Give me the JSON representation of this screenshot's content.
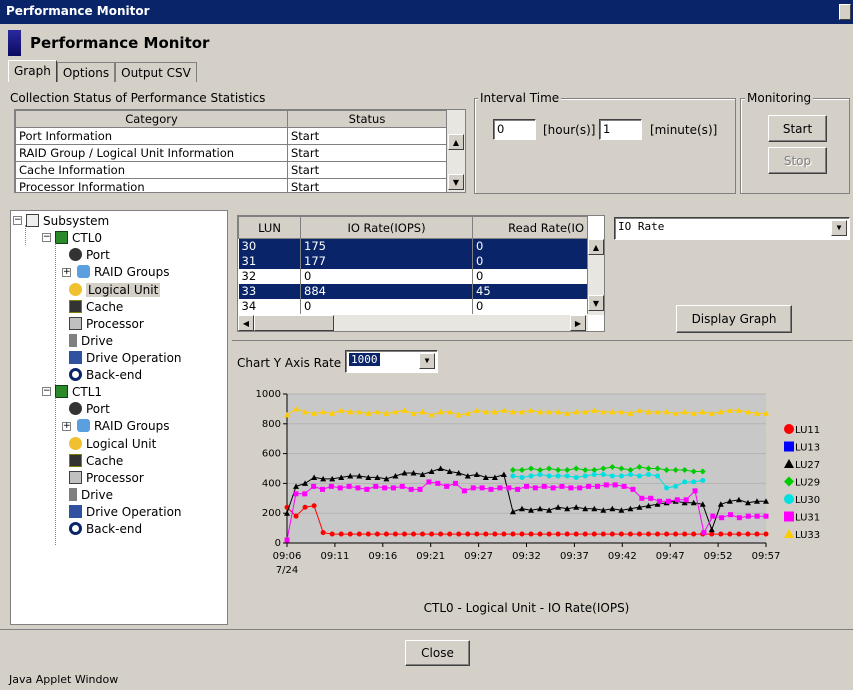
{
  "window": {
    "title": "Performance Monitor"
  },
  "header": {
    "title": "Performance Monitor"
  },
  "tabs": [
    {
      "label": "Graph"
    },
    {
      "label": "Options"
    },
    {
      "label": "Output CSV"
    }
  ],
  "collection": {
    "title": "Collection Status of Performance Statistics",
    "col_category": "Category",
    "col_status": "Status",
    "rows": [
      {
        "category": "Port Information",
        "status": "Start"
      },
      {
        "category": "RAID Group / Logical Unit Information",
        "status": "Start"
      },
      {
        "category": "Cache Information",
        "status": "Start"
      },
      {
        "category": "Processor Information",
        "status": "Start"
      }
    ]
  },
  "interval": {
    "title": "Interval Time",
    "hours_value": "0",
    "hours_label": "[hour(s)]",
    "minutes_value": "1",
    "minutes_label": "[minute(s)]"
  },
  "monitoring": {
    "title": "Monitoring",
    "start": "Start",
    "stop": "Stop"
  },
  "tree": {
    "root": "Subsystem",
    "controllers": [
      {
        "label": "CTL0",
        "items": [
          "Port",
          "RAID Groups",
          "Logical Unit",
          "Cache",
          "Processor",
          "Drive",
          "Drive Operation",
          "Back-end"
        ]
      },
      {
        "label": "CTL1",
        "items": [
          "Port",
          "RAID Groups",
          "Logical Unit",
          "Cache",
          "Processor",
          "Drive",
          "Drive Operation",
          "Back-end"
        ]
      }
    ]
  },
  "lun_table": {
    "headers": [
      "LUN",
      "IO Rate(IOPS)",
      "Read Rate(IO"
    ],
    "rows": [
      [
        "30",
        "175",
        "0"
      ],
      [
        "31",
        "177",
        "0"
      ],
      [
        "32",
        "0",
        "0"
      ],
      [
        "33",
        "884",
        "45"
      ],
      [
        "34",
        "0",
        "0"
      ]
    ]
  },
  "metric_select": {
    "value": "IO Rate"
  },
  "display_graph": "Display Graph",
  "axis_rate": {
    "label": "Chart Y Axis Rate",
    "value": "1000"
  },
  "chart_data": {
    "type": "line",
    "title": "CTL0 - Logical Unit - IO Rate(IOPS)",
    "xlabel": "",
    "ylabel": "",
    "ylim": [
      0,
      1000
    ],
    "y_ticks": [
      "0",
      "200",
      "400",
      "600",
      "800",
      "1000"
    ],
    "x_ticks": [
      "09:06",
      "09:11",
      "09:16",
      "09:21",
      "09:27",
      "09:32",
      "09:37",
      "09:42",
      "09:47",
      "09:52",
      "09:57"
    ],
    "x_date": "7/24",
    "legend_position": "right",
    "series": [
      {
        "name": "LU11",
        "color": "#ff0000",
        "marker": "circle",
        "values": [
          240,
          180,
          240,
          250,
          70,
          60,
          60,
          60,
          60,
          60,
          60,
          60,
          60,
          60,
          60,
          60,
          60,
          60,
          60,
          60,
          60,
          60,
          60,
          60,
          60,
          60,
          60,
          60,
          60,
          60,
          60,
          60,
          60,
          60,
          60,
          60,
          60,
          60,
          60,
          60,
          60,
          60,
          60,
          60,
          60,
          60,
          60,
          60,
          60,
          60,
          60,
          60,
          60,
          60
        ]
      },
      {
        "name": "LU13",
        "color": "#0000ff",
        "marker": "square",
        "values": [
          null,
          null,
          null,
          null,
          null,
          null,
          null,
          null,
          null,
          null,
          null,
          null,
          null,
          null,
          null,
          null,
          null,
          null,
          null,
          null,
          null,
          null,
          null,
          null,
          null,
          null,
          null,
          null,
          null,
          null,
          null,
          null,
          null,
          null,
          null,
          null,
          null,
          null,
          null,
          null,
          null,
          null,
          null,
          null,
          null,
          null,
          null,
          null,
          null,
          null,
          null,
          null,
          null,
          null
        ]
      },
      {
        "name": "LU27",
        "color": "#000000",
        "marker": "triangle",
        "values": [
          200,
          380,
          400,
          440,
          430,
          430,
          440,
          450,
          450,
          440,
          440,
          430,
          450,
          470,
          470,
          460,
          480,
          500,
          480,
          470,
          450,
          460,
          440,
          440,
          460,
          210,
          230,
          220,
          230,
          220,
          240,
          230,
          240,
          230,
          230,
          220,
          230,
          220,
          230,
          240,
          250,
          260,
          270,
          280,
          270,
          270,
          260,
          90,
          260,
          280,
          290,
          270,
          280,
          280
        ]
      },
      {
        "name": "LU29",
        "color": "#00cc00",
        "marker": "diamond",
        "values": [
          null,
          null,
          null,
          null,
          null,
          null,
          null,
          null,
          null,
          null,
          null,
          null,
          null,
          null,
          null,
          null,
          null,
          null,
          null,
          null,
          null,
          null,
          null,
          null,
          null,
          490,
          490,
          500,
          490,
          500,
          490,
          490,
          500,
          490,
          490,
          500,
          510,
          500,
          490,
          510,
          500,
          500,
          490,
          490,
          490,
          480,
          480,
          null,
          null,
          null,
          null,
          null,
          null,
          null
        ]
      },
      {
        "name": "LU30",
        "color": "#00e0e0",
        "marker": "circle",
        "values": [
          null,
          null,
          null,
          null,
          null,
          null,
          null,
          null,
          null,
          null,
          null,
          null,
          null,
          null,
          null,
          null,
          null,
          null,
          null,
          null,
          null,
          null,
          null,
          null,
          null,
          450,
          440,
          450,
          460,
          450,
          450,
          450,
          440,
          450,
          460,
          460,
          450,
          450,
          460,
          450,
          460,
          450,
          370,
          380,
          410,
          410,
          420,
          null,
          null,
          null,
          null,
          null,
          null,
          null
        ]
      },
      {
        "name": "LU31",
        "color": "#ff00ff",
        "marker": "square",
        "values": [
          20,
          330,
          330,
          380,
          360,
          380,
          370,
          380,
          370,
          360,
          380,
          370,
          370,
          380,
          360,
          360,
          410,
          400,
          380,
          400,
          350,
          370,
          370,
          360,
          370,
          370,
          360,
          380,
          370,
          380,
          370,
          380,
          370,
          370,
          380,
          380,
          390,
          390,
          380,
          360,
          300,
          300,
          280,
          280,
          290,
          290,
          350,
          70,
          180,
          170,
          190,
          170,
          180,
          180,
          180
        ]
      },
      {
        "name": "LU33",
        "color": "#ffcc00",
        "marker": "triangle",
        "values": [
          860,
          900,
          880,
          870,
          880,
          870,
          890,
          880,
          880,
          870,
          880,
          870,
          880,
          890,
          870,
          880,
          860,
          880,
          880,
          860,
          870,
          890,
          880,
          880,
          890,
          880,
          880,
          890,
          880,
          880,
          880,
          870,
          880,
          880,
          890,
          880,
          880,
          880,
          870,
          890,
          880,
          880,
          880,
          870,
          880,
          870,
          880,
          870,
          880,
          890,
          890,
          880,
          870,
          870
        ]
      }
    ]
  },
  "close": "Close",
  "statusbar": "Java Applet Window"
}
